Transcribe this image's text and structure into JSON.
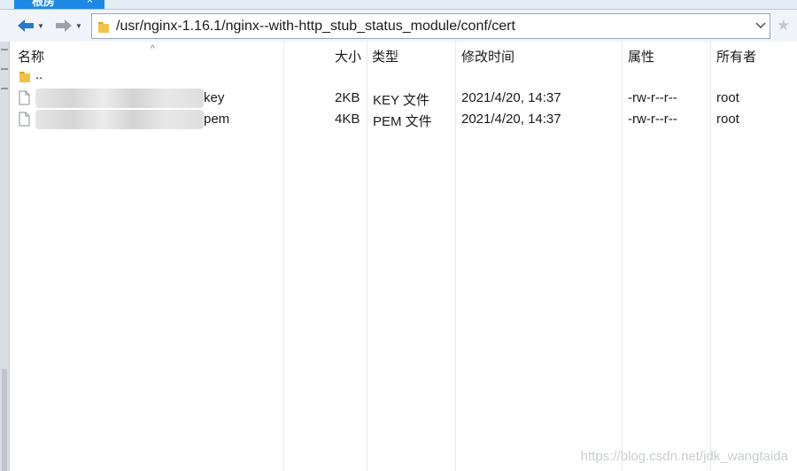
{
  "tab": {
    "label": "根房",
    "close": "×"
  },
  "address": {
    "path": "/usr/nginx-1.16.1/nginx--with-http_stub_status_module/conf/cert"
  },
  "columns": {
    "name": "名称",
    "size": "大小",
    "type": "类型",
    "modified": "修改时间",
    "attributes": "属性",
    "owner": "所有者"
  },
  "parent_dir": {
    "name": ".."
  },
  "files": [
    {
      "name": "key",
      "size": "2KB",
      "type": "KEY 文件",
      "modified": "2021/4/20, 14:37",
      "attributes": "-rw-r--r--",
      "owner": "root"
    },
    {
      "name": "pem",
      "size": "4KB",
      "type": "PEM 文件",
      "modified": "2021/4/20, 14:37",
      "attributes": "-rw-r--r--",
      "owner": "root"
    }
  ],
  "watermark": "https://blog.csdn.net/jdk_wangtaida",
  "colors": {
    "accent": "#1e88e5",
    "folder": "#f0c24b",
    "nav_arrow": "#2b79c9"
  }
}
